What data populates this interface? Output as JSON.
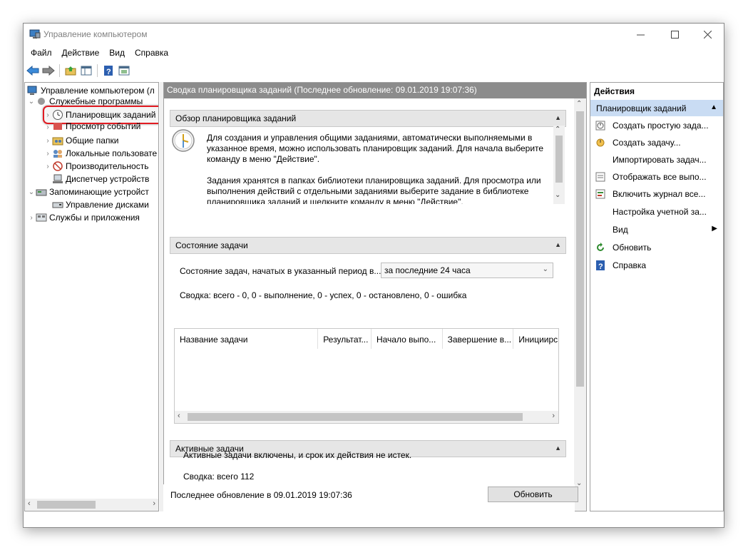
{
  "window": {
    "title": "Управление компьютером",
    "icon": "computer-management-icon"
  },
  "menu": [
    "Файл",
    "Действие",
    "Вид",
    "Справка"
  ],
  "toolbar": [
    "back-icon",
    "forward-icon",
    "up-folder-icon",
    "show-hide-tree-icon",
    "help-icon",
    "properties-icon"
  ],
  "tree": {
    "root": "Управление компьютером (л",
    "sys_tools": "Служебные программы",
    "task_scheduler": "Планировщик заданий",
    "event_viewer": "Просмотр событий",
    "shared_folders": "Общие папки",
    "local_users": "Локальные пользовате",
    "performance": "Производительность",
    "device_manager": "Диспетчер устройств",
    "storage": "Запоминающие устройст",
    "disk_management": "Управление дисками",
    "services_apps": "Службы и приложения"
  },
  "center": {
    "header": "Сводка планировщика заданий (Последнее обновление: 09.01.2019 19:07:36)",
    "overview_title": "Обзор планировщика заданий",
    "overview_p1": "Для создания и управления общими заданиями, автоматически выполняемыми в указанное время, можно использовать планировщик заданий. Для начала выберите команду в меню \"Действие\".",
    "overview_p2": "Задания хранятся в папках библиотеки планировщика заданий. Для просмотра или выполнения действий с отдельными заданиями выберите задание в библиотеке планировщика заданий и щелкните команду в меню \"Действие\".",
    "status_title": "Состояние задачи",
    "status_label": "Состояние задач, начатых в указанный период в...",
    "period_value": "за последние 24 часа",
    "summary": "Сводка: всего - 0, 0 - выполнение, 0 - успех, 0 - остановлено, 0 - ошибка",
    "columns": [
      "Название задачи",
      "Результат...",
      "Начало выпо...",
      "Завершение в...",
      "Инициирс"
    ],
    "active_title": "Активные задачи",
    "active_text": "Активные задачи включены, и срок их действия не истек.",
    "active_summary": "Сводка: всего 112",
    "last_update": "Последнее обновление в 09.01.2019 19:07:36",
    "refresh_button": "Обновить"
  },
  "actions": {
    "title": "Действия",
    "group": "Планировщик заданий",
    "items": [
      {
        "label": "Создать простую зада...",
        "icon": "create-basic-task-icon"
      },
      {
        "label": "Создать задачу...",
        "icon": "create-task-icon"
      },
      {
        "label": "Импортировать задач...",
        "icon": ""
      },
      {
        "label": "Отображать все выпо...",
        "icon": "display-running-tasks-icon"
      },
      {
        "label": "Включить журнал все...",
        "icon": "enable-history-icon"
      },
      {
        "label": "Настройка учетной за...",
        "icon": ""
      },
      {
        "label": "Вид",
        "icon": ""
      },
      {
        "label": "Обновить",
        "icon": "refresh-icon"
      },
      {
        "label": "Справка",
        "icon": "help-icon"
      }
    ]
  },
  "colors": {
    "center_header_bg": "#8c8c8c",
    "actions_group_bg": "#c9dcf3",
    "highlight_ring": "#e11b22"
  }
}
